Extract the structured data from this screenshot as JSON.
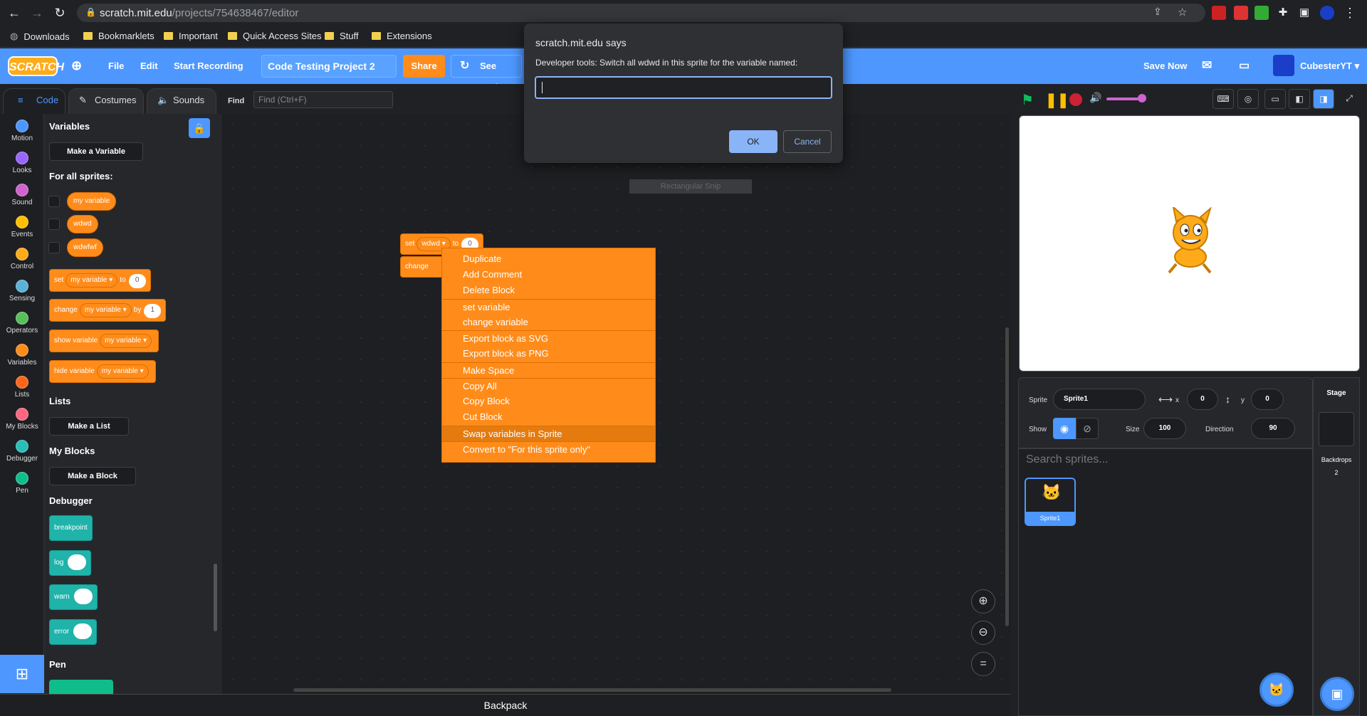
{
  "browser": {
    "url_domain": "scratch.mit.edu",
    "url_path": "/projects/754638467/editor",
    "bookmarks": [
      "Downloads",
      "Bookmarklets",
      "Important",
      "Quick Access Sites",
      "Stuff",
      "Extensions"
    ]
  },
  "menubar": {
    "logo": "SCRATCH",
    "file": "File",
    "edit": "Edit",
    "start_recording": "Start Recording",
    "project_title": "Code Testing Project 2",
    "share": "Share",
    "see_project": "See Project",
    "save_now": "Save Now",
    "username": "CubesterYT"
  },
  "tabs": {
    "code": "Code",
    "costumes": "Costumes",
    "sounds": "Sounds"
  },
  "find": {
    "label": "Find",
    "placeholder": "Find (Ctrl+F)"
  },
  "categories": [
    {
      "label": "Motion",
      "color": "#4c97ff"
    },
    {
      "label": "Looks",
      "color": "#9966ff"
    },
    {
      "label": "Sound",
      "color": "#cf63cf"
    },
    {
      "label": "Events",
      "color": "#ffbf00"
    },
    {
      "label": "Control",
      "color": "#ffab19"
    },
    {
      "label": "Sensing",
      "color": "#5cb1d6"
    },
    {
      "label": "Operators",
      "color": "#59c059"
    },
    {
      "label": "Variables",
      "color": "#ff8c1a"
    },
    {
      "label": "Lists",
      "color": "#ff661a"
    },
    {
      "label": "My Blocks",
      "color": "#ff6680"
    },
    {
      "label": "Debugger",
      "color": "#29beb8"
    },
    {
      "label": "Pen",
      "color": "#0fbd8c"
    }
  ],
  "palette": {
    "variables_head": "Variables",
    "make_variable": "Make a Variable",
    "for_all_sprites": "For all sprites:",
    "variables": [
      "my variable",
      "wdwd",
      "wdwfwf"
    ],
    "set_block": {
      "verb": "set",
      "var": "my variable",
      "to": "to",
      "value": "0"
    },
    "change_block": {
      "verb": "change",
      "var": "my variable",
      "by": "by",
      "value": "1"
    },
    "show_block": {
      "verb": "show variable",
      "var": "my variable"
    },
    "hide_block": {
      "verb": "hide variable",
      "var": "my variable"
    },
    "lists_head": "Lists",
    "make_list": "Make a List",
    "myblocks_head": "My Blocks",
    "make_block": "Make a Block",
    "debugger_head": "Debugger",
    "debugger_blocks": [
      "breakpoint",
      "log",
      "warn",
      "error"
    ],
    "pen_head": "Pen"
  },
  "workspace": {
    "set_block": {
      "verb": "set",
      "var": "wdwd",
      "to": "to",
      "value": "0"
    },
    "change_block": {
      "verb": "change"
    },
    "snip_text": "Rectangular Snip"
  },
  "context_menu": {
    "items": [
      "Duplicate",
      "Add Comment",
      "Delete Block",
      "set variable",
      "change variable",
      "Export block as SVG",
      "Export block as PNG",
      "Make Space",
      "Copy All",
      "Copy Block",
      "Cut Block",
      "Swap variables in Sprite",
      "Convert to \"For this sprite only\""
    ],
    "highlighted": "Swap variables in Sprite"
  },
  "dialog": {
    "title": "scratch.mit.edu says",
    "message": "Developer tools: Switch all wdwd in this sprite for the variable named:",
    "input_value": "",
    "ok": "OK",
    "cancel": "Cancel"
  },
  "sprite_info": {
    "sprite_label": "Sprite",
    "sprite_name": "Sprite1",
    "x_label": "x",
    "x_value": "0",
    "y_label": "y",
    "y_value": "0",
    "show_label": "Show",
    "size_label": "Size",
    "size_value": "100",
    "direction_label": "Direction",
    "direction_value": "90",
    "search_placeholder": "Search sprites...",
    "sprite_thumb_name": "Sprite1"
  },
  "stage_pane": {
    "title": "Stage",
    "backdrops_label": "Backdrops",
    "backdrops_count": "2"
  },
  "backpack": "Backpack"
}
